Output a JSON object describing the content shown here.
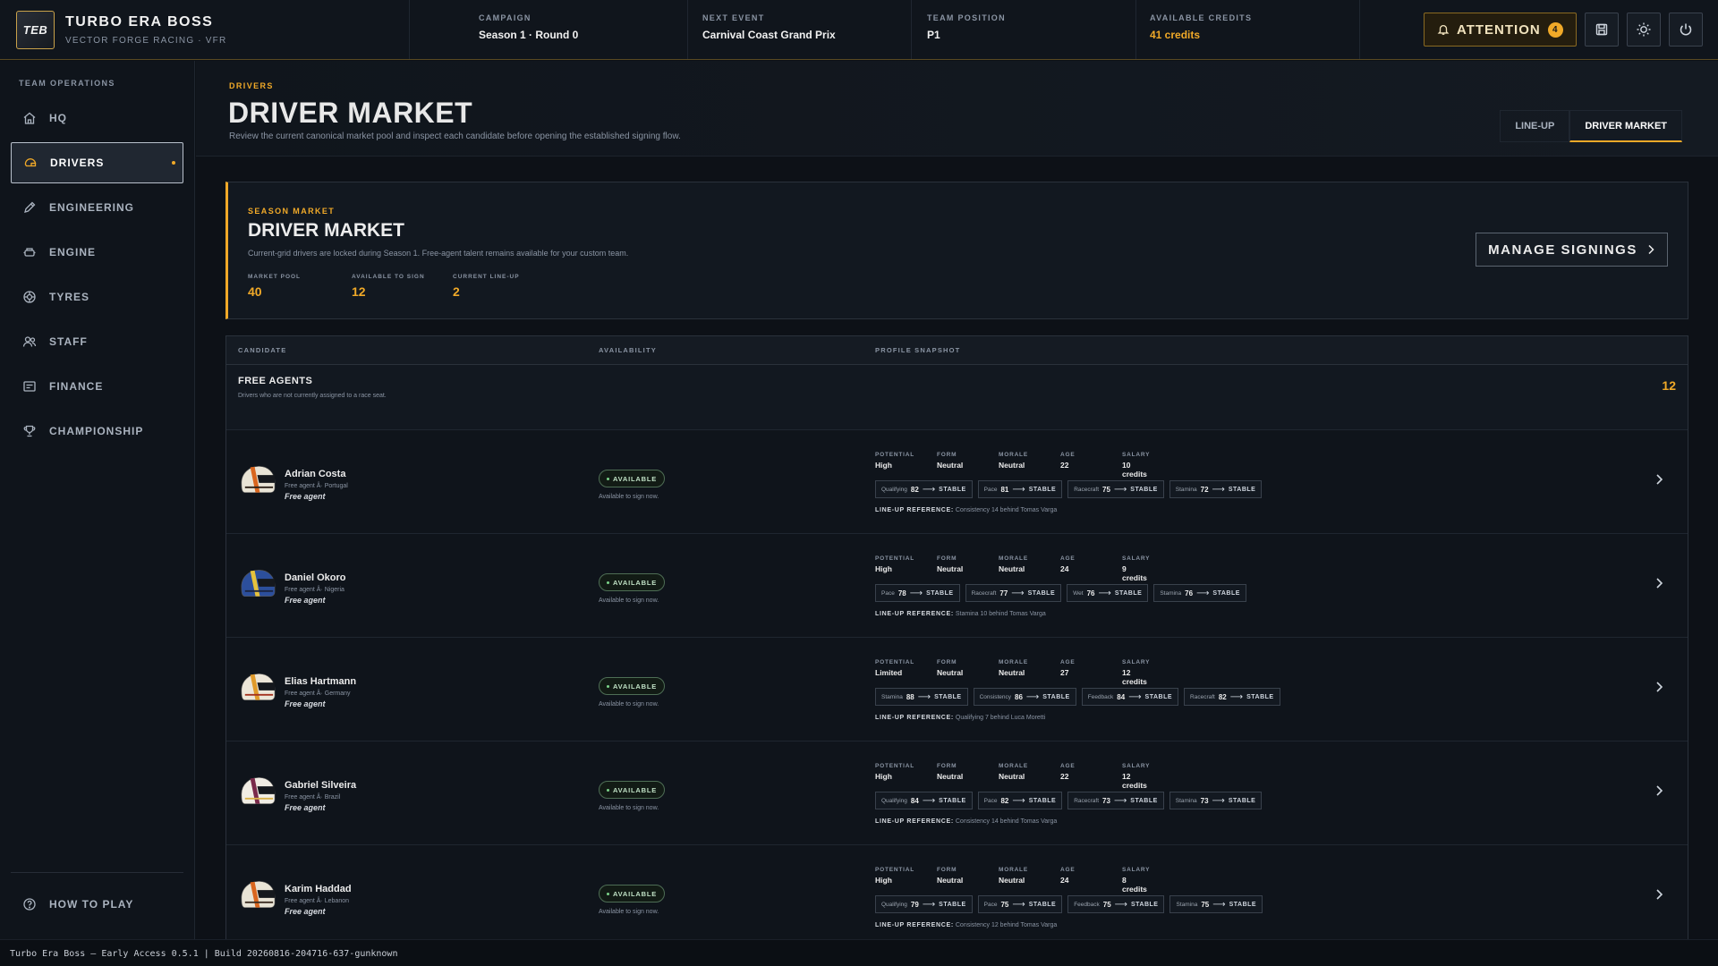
{
  "app": {
    "logo": "TEB",
    "title": "TURBO ERA BOSS",
    "team": "VECTOR FORGE RACING · VFR"
  },
  "topbar": {
    "stats": [
      {
        "label": "CAMPAIGN",
        "value": "Season 1 · Round 0"
      },
      {
        "label": "NEXT EVENT",
        "value": "Carnival Coast Grand Prix"
      },
      {
        "label": "TEAM POSITION",
        "value": "P1"
      },
      {
        "label": "AVAILABLE CREDITS",
        "value": "41 credits"
      }
    ],
    "attention_label": "ATTENTION",
    "attention_count": "4",
    "icons": [
      "bell-icon",
      "save-icon",
      "brightness-icon",
      "power-icon"
    ]
  },
  "sidebar": {
    "heading": "TEAM OPERATIONS",
    "items": [
      {
        "label": "HQ",
        "icon": "home-icon"
      },
      {
        "label": "DRIVERS",
        "icon": "helmet-icon",
        "active": true
      },
      {
        "label": "ENGINEERING",
        "icon": "pencil-icon"
      },
      {
        "label": "ENGINE",
        "icon": "engine-icon"
      },
      {
        "label": "TYRES",
        "icon": "tyre-icon"
      },
      {
        "label": "STAFF",
        "icon": "people-icon"
      },
      {
        "label": "FINANCE",
        "icon": "finance-icon"
      },
      {
        "label": "CHAMPIONSHIP",
        "icon": "trophy-icon"
      }
    ],
    "footer_label": "HOW TO PLAY"
  },
  "page": {
    "eyebrow": "DRIVERS",
    "title": "DRIVER MARKET",
    "description": "Review the current canonical market pool and inspect each candidate before opening the established signing flow.",
    "tabs": [
      "LINE-UP",
      "DRIVER MARKET"
    ],
    "active_tab": "DRIVER MARKET"
  },
  "market": {
    "eyebrow": "SEASON MARKET",
    "title": "DRIVER MARKET",
    "description": "Current-grid drivers are locked during Season 1. Free-agent talent remains available for your custom team.",
    "metrics": [
      {
        "label": "MARKET POOL",
        "value": "40"
      },
      {
        "label": "AVAILABLE TO SIGN",
        "value": "12"
      },
      {
        "label": "CURRENT LINE-UP",
        "value": "2"
      }
    ],
    "manage_label": "MANAGE SIGNINGS"
  },
  "table": {
    "headers": [
      "CANDIDATE",
      "AVAILABILITY",
      "PROFILE SNAPSHOT"
    ],
    "group": {
      "title": "FREE AGENTS",
      "subtitle": "Drivers who are not currently assigned to a race seat.",
      "count": "12"
    },
    "profile_labels": [
      "POTENTIAL",
      "FORM",
      "MORALE",
      "AGE",
      "SALARY"
    ],
    "lineup_ref_label": "LINE-UP REFERENCE:",
    "rows": [
      {
        "name": "Adrian Costa",
        "origin": "Free agent Â· Portugal",
        "status": "Free agent",
        "avail": "AVAILABLE",
        "avail_sub": "Available to sign now.",
        "profile": [
          "High",
          "Neutral",
          "Neutral",
          "22",
          "10 credits"
        ],
        "chips": [
          {
            "label": "Qualifying",
            "value": "82",
            "trend": "STABLE"
          },
          {
            "label": "Pace",
            "value": "81",
            "trend": "STABLE"
          },
          {
            "label": "Racecraft",
            "value": "75",
            "trend": "STABLE"
          },
          {
            "label": "Stamina",
            "value": "72",
            "trend": "STABLE"
          }
        ],
        "lineup": "Consistency 14 behind Tomas Varga",
        "helmet": {
          "main": "#e9e4d6",
          "stripe": "#d9661f",
          "accent": "#2a1e16"
        }
      },
      {
        "name": "Daniel Okoro",
        "origin": "Free agent Â· Nigeria",
        "status": "Free agent",
        "avail": "AVAILABLE",
        "avail_sub": "Available to sign now.",
        "profile": [
          "High",
          "Neutral",
          "Neutral",
          "24",
          "9 credits"
        ],
        "chips": [
          {
            "label": "Pace",
            "value": "78",
            "trend": "STABLE"
          },
          {
            "label": "Racecraft",
            "value": "77",
            "trend": "STABLE"
          },
          {
            "label": "Wet",
            "value": "76",
            "trend": "STABLE"
          },
          {
            "label": "Stamina",
            "value": "76",
            "trend": "STABLE"
          }
        ],
        "lineup": "Stamina 10 behind Tomas Varga",
        "helmet": {
          "main": "#2c4f9c",
          "stripe": "#e6c23c",
          "accent": "#1b2440"
        }
      },
      {
        "name": "Elias Hartmann",
        "origin": "Free agent Â· Germany",
        "status": "Free agent",
        "avail": "AVAILABLE",
        "avail_sub": "Available to sign now.",
        "profile": [
          "Limited",
          "Neutral",
          "Neutral",
          "27",
          "12 credits"
        ],
        "chips": [
          {
            "label": "Stamina",
            "value": "88",
            "trend": "STABLE"
          },
          {
            "label": "Consistency",
            "value": "86",
            "trend": "STABLE"
          },
          {
            "label": "Feedback",
            "value": "84",
            "trend": "STABLE"
          },
          {
            "label": "Racecraft",
            "value": "82",
            "trend": "STABLE"
          }
        ],
        "lineup": "Qualifying 7 behind Luca Moretti",
        "helmet": {
          "main": "#ece6d8",
          "stripe": "#e09a2a",
          "accent": "#a3321f"
        }
      },
      {
        "name": "Gabriel Silveira",
        "origin": "Free agent Â· Brazil",
        "status": "Free agent",
        "avail": "AVAILABLE",
        "avail_sub": "Available to sign now.",
        "profile": [
          "High",
          "Neutral",
          "Neutral",
          "22",
          "12 credits"
        ],
        "chips": [
          {
            "label": "Qualifying",
            "value": "84",
            "trend": "STABLE"
          },
          {
            "label": "Pace",
            "value": "82",
            "trend": "STABLE"
          },
          {
            "label": "Racecraft",
            "value": "73",
            "trend": "STABLE"
          },
          {
            "label": "Stamina",
            "value": "73",
            "trend": "STABLE"
          }
        ],
        "lineup": "Consistency 14 behind Tomas Varga",
        "helmet": {
          "main": "#f1ede4",
          "stripe": "#7a2a4a",
          "accent": "#d9b24a"
        }
      },
      {
        "name": "Karim Haddad",
        "origin": "Free agent Â· Lebanon",
        "status": "Free agent",
        "avail": "AVAILABLE",
        "avail_sub": "Available to sign now.",
        "profile": [
          "High",
          "Neutral",
          "Neutral",
          "24",
          "8 credits"
        ],
        "chips": [
          {
            "label": "Qualifying",
            "value": "79",
            "trend": "STABLE"
          },
          {
            "label": "Pace",
            "value": "75",
            "trend": "STABLE"
          },
          {
            "label": "Feedback",
            "value": "75",
            "trend": "STABLE"
          },
          {
            "label": "Stamina",
            "value": "75",
            "trend": "STABLE"
          }
        ],
        "lineup": "Consistency 12 behind Tomas Varga",
        "helmet": {
          "main": "#e9e4d6",
          "stripe": "#d9661f",
          "accent": "#3b2c22"
        }
      }
    ]
  },
  "status_bar": "Turbo Era Boss — Early Access 0.5.1 | Build 20260816-204716-637-gunknown",
  "colors": {
    "accent": "#f0a928",
    "available": "#7bd48a"
  }
}
